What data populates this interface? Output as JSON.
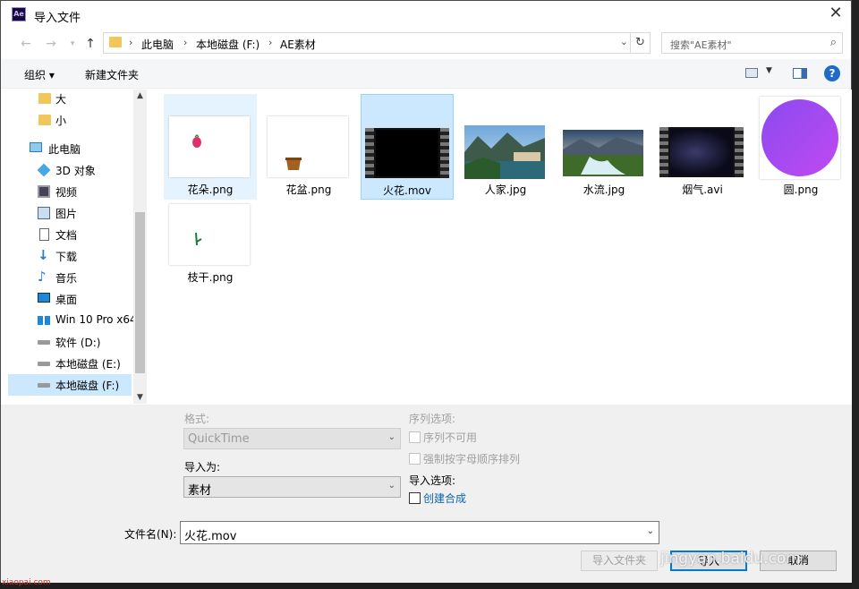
{
  "window": {
    "title": "导入文件",
    "app_icon": "Ae",
    "close_label": "✕"
  },
  "address": {
    "segments": [
      "此电脑",
      "本地磁盘 (F:)",
      "AE素材"
    ],
    "search_placeholder": "搜索\"AE素材\""
  },
  "toolbar": {
    "organize": "组织 ▾",
    "new_folder": "新建文件夹",
    "help": "?"
  },
  "nav": {
    "items": [
      {
        "label": "大",
        "icon": "folder-icon"
      },
      {
        "label": "小",
        "icon": "folder-icon"
      },
      {
        "label": "此电脑",
        "icon": "computer-icon"
      },
      {
        "label": "3D 对象",
        "icon": "3d-objects-icon"
      },
      {
        "label": "视频",
        "icon": "video-icon"
      },
      {
        "label": "图片",
        "icon": "pictures-icon"
      },
      {
        "label": "文档",
        "icon": "documents-icon"
      },
      {
        "label": "下载",
        "icon": "download-icon"
      },
      {
        "label": "音乐",
        "icon": "music-icon"
      },
      {
        "label": "桌面",
        "icon": "desktop-icon"
      },
      {
        "label": "Win 10 Pro x64",
        "icon": "windows-drive-icon"
      },
      {
        "label": "软件 (D:)",
        "icon": "drive-icon"
      },
      {
        "label": "本地磁盘 (E:)",
        "icon": "drive-icon"
      },
      {
        "label": "本地磁盘 (F:)",
        "icon": "drive-icon"
      }
    ],
    "selected": "本地磁盘 (F:)"
  },
  "files": [
    {
      "name": "花朵.png",
      "kind": "png",
      "state": "hover"
    },
    {
      "name": "花盆.png",
      "kind": "png",
      "state": ""
    },
    {
      "name": "火花.mov",
      "kind": "video",
      "state": "selected"
    },
    {
      "name": "人家.jpg",
      "kind": "photo",
      "state": ""
    },
    {
      "name": "水流.jpg",
      "kind": "photo",
      "state": ""
    },
    {
      "name": "烟气.avi",
      "kind": "video",
      "state": ""
    },
    {
      "name": "圆.png",
      "kind": "png",
      "state": ""
    },
    {
      "name": "枝干.png",
      "kind": "png",
      "state": ""
    }
  ],
  "options": {
    "format_label": "格式:",
    "format_value": "QuickTime",
    "import_as_label": "导入为:",
    "import_as_value": "素材",
    "sequence_label": "序列选项:",
    "sequence_unavailable": "序列不可用",
    "force_alpha": "强制按字母顺序排列",
    "import_options_label": "导入选项:",
    "create_comp": "创建合成"
  },
  "filename": {
    "label": "文件名(N):",
    "value": "火花.mov"
  },
  "buttons": {
    "import_folder": "导入文件夹",
    "import": "导入",
    "cancel": "取消"
  },
  "watermark": "jingyan.baidu.com",
  "corner_url": "xiaopai.com"
}
